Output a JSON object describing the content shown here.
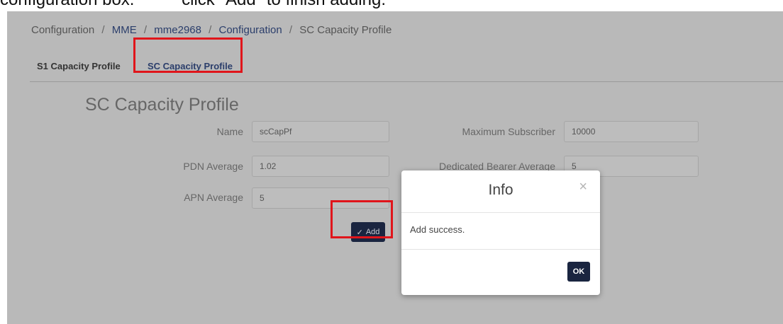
{
  "caption": {
    "left": "configuration box.",
    "right": "click \"Add\" to finish adding."
  },
  "breadcrumb": {
    "items": [
      "Configuration",
      "MME",
      "mme2968",
      "Configuration",
      "SC Capacity Profile"
    ],
    "separator": "/"
  },
  "tabs": [
    {
      "label": "S1 Capacity Profile"
    },
    {
      "label": "SC Capacity Profile"
    }
  ],
  "section": {
    "title": "SC Capacity Profile"
  },
  "form": {
    "name": {
      "label": "Name",
      "value": "scCapPf"
    },
    "pdn_average": {
      "label": "PDN Average",
      "value": "1.02"
    },
    "apn_average": {
      "label": "APN Average",
      "value": "5"
    },
    "max_subscriber": {
      "label": "Maximum Subscriber",
      "value": "10000"
    },
    "dedicated_bearer": {
      "label": "Dedicated Bearer Average",
      "value": "5"
    },
    "add_label": "Add"
  },
  "modal": {
    "title": "Info",
    "message": "Add success.",
    "ok_label": "OK",
    "close_glyph": "×"
  },
  "icons": {
    "add_icon": "check-underline-icon",
    "close_icon": "close-icon"
  },
  "colors": {
    "highlight": "#e0151b",
    "primary_button": "#1a2540",
    "link": "#2b3e6b"
  }
}
